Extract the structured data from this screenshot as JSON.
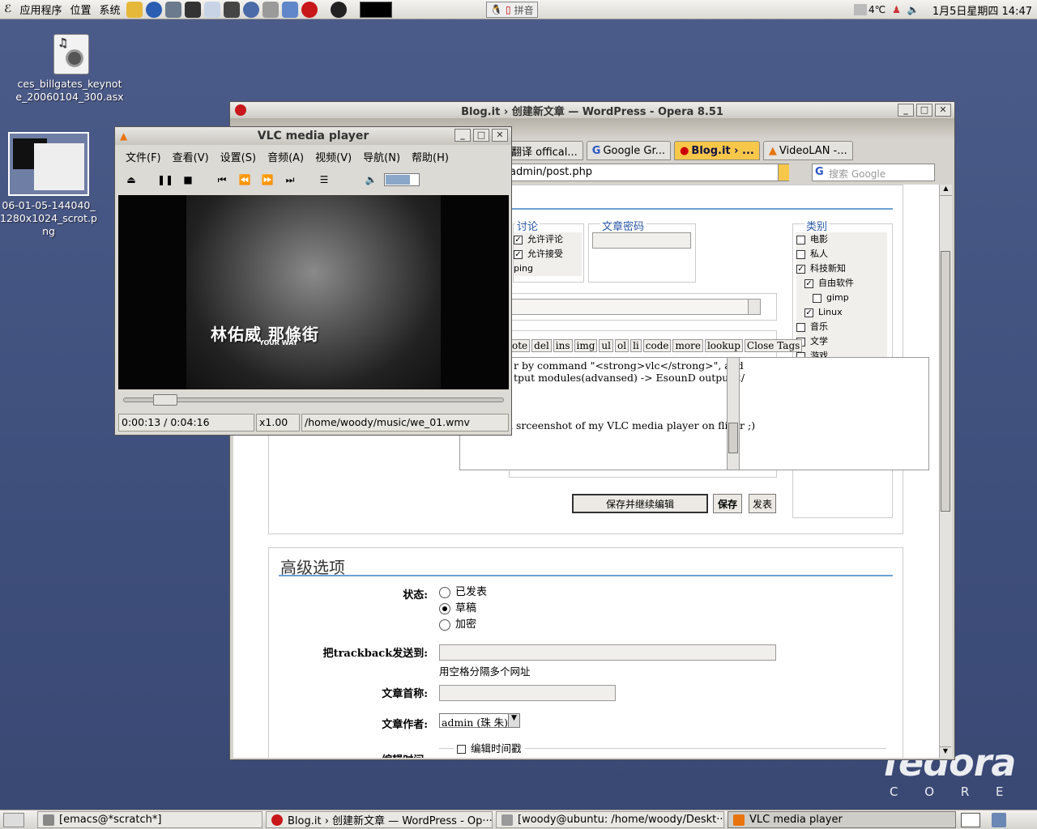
{
  "top_panel": {
    "menus": [
      "应用程序",
      "位置",
      "系统"
    ],
    "input_method": "拼音",
    "weather": "4℃",
    "clock": "1月5日星期四 14:47"
  },
  "desktop_icons": [
    {
      "label": "ces_billgates_keynote_20060104_300.asx",
      "icon": "audio-file-icon"
    },
    {
      "label": "06-01-05-144040_1280x1024_scrot.png",
      "icon": "image-thumbnail-icon"
    }
  ],
  "opera": {
    "title": "Blog.it › 创建新文章 — WordPress - Opera 8.51",
    "tabs": [
      "翻译 offical...",
      "Google Gr...",
      "Blog.it › ...",
      "VideoLAN -..."
    ],
    "address": "admin/post.php",
    "search_placeholder": "搜索 Google",
    "discussion": {
      "legend": "讨论",
      "allow_comments": "允许评论",
      "allow_pings": "允许接受ping"
    },
    "password": {
      "legend": "文章密码"
    },
    "categories": {
      "legend": "类别",
      "items": [
        {
          "label": "电影",
          "checked": false
        },
        {
          "label": "私人",
          "checked": false
        },
        {
          "label": "科技新知",
          "checked": true
        },
        {
          "label": "自由软件",
          "checked": true
        },
        {
          "label": "gimp",
          "checked": false
        },
        {
          "label": "Linux",
          "checked": true
        },
        {
          "label": "音乐",
          "checked": false
        },
        {
          "label": "文学",
          "checked": false
        },
        {
          "label": "游戏",
          "checked": false
        }
      ]
    },
    "quicktags": [
      "ote",
      "del",
      "ins",
      "img",
      "ul",
      "ol",
      "li",
      "code",
      "more",
      "lookup",
      "Close Tags"
    ],
    "editor_lines": [
      "r by command \"<strong>vlc</strong>\", and",
      "tput modules(advansed) -> EsounD output</",
      "There is a srceenshot of my VLC media player on flickr ;)"
    ],
    "buttons": {
      "save_continue": "保存并继续编辑",
      "save": "保存",
      "publish": "发表"
    },
    "advanced": {
      "title": "高级选项",
      "status_label": "状态:",
      "status_options": [
        "已发表",
        "草稿",
        "加密"
      ],
      "status_selected": "草稿",
      "trackback_label": "把trackback发送到:",
      "trackback_hint": "用空格分隔多个网址",
      "slug_label": "文章首称:",
      "author_label": "文章作者:",
      "author_value": "admin (珠 朱)",
      "edit_time_label": "编辑时间:",
      "edit_time_checkbox": "编辑时间戳"
    }
  },
  "vlc": {
    "title": "VLC media player",
    "menus": [
      "文件(F)",
      "查看(V)",
      "设置(S)",
      "音频(A)",
      "视频(V)",
      "导航(N)",
      "帮助(H)"
    ],
    "video_caption": "林佑威 那條街",
    "video_caption_small": "YOUR WAY",
    "progress": 0.054,
    "time": "0:00:13 / 0:04:16",
    "speed": "x1.00",
    "file": "/home/woody/music/we_01.wmv"
  },
  "taskbar": [
    "[emacs@*scratch*]",
    "Blog.it › 创建新文章 — WordPress - Op···",
    "[woody@ubuntu: /home/woody/Deskt···",
    "VLC media player"
  ],
  "watermark": {
    "word": "fedora",
    "sub": "C O R E"
  }
}
